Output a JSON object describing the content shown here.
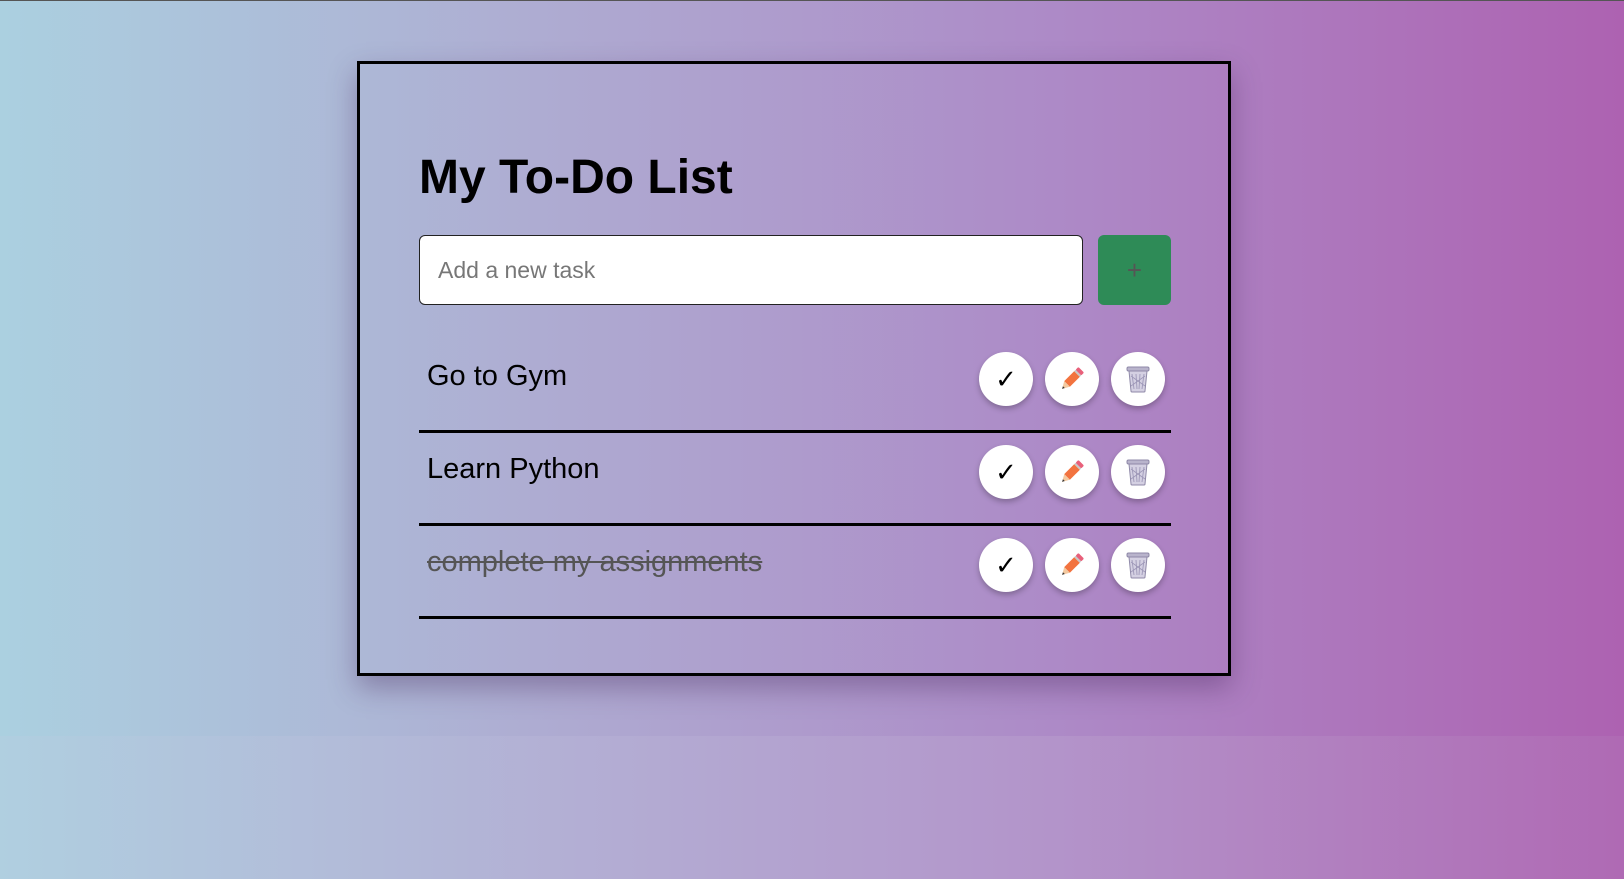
{
  "app": {
    "title": "My To-Do List"
  },
  "input": {
    "placeholder": "Add a new task",
    "value": ""
  },
  "add_button": {
    "label": "+"
  },
  "tasks": [
    {
      "text": "Go to Gym",
      "completed": false
    },
    {
      "text": "Learn Python",
      "completed": false
    },
    {
      "text": "complete my assignments",
      "completed": true
    }
  ],
  "actions": {
    "complete_icon": "check-icon",
    "complete_glyph": "✓",
    "edit_icon": "pencil-icon",
    "delete_icon": "trash-icon"
  },
  "colors": {
    "add_button": "#2e8b57",
    "pencil": "#f2733f",
    "trash": "#a9a3bf"
  }
}
